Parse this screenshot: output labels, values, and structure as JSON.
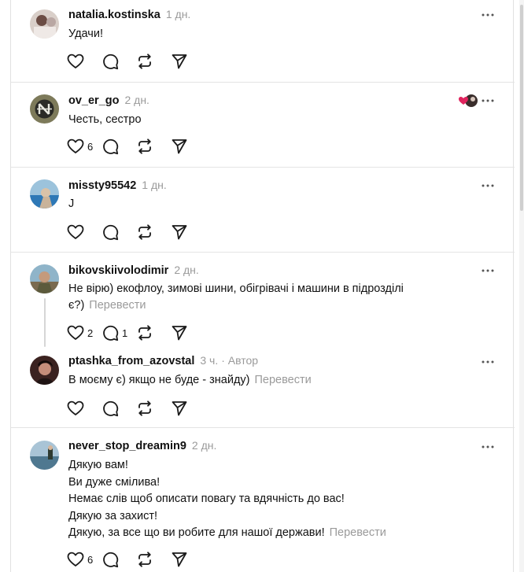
{
  "posts": [
    {
      "username": "natalia.kostinska",
      "time": "1 дн.",
      "lines": [
        "Удачи!"
      ],
      "translate": "",
      "likes": "",
      "replies": ""
    },
    {
      "username": "ov_er_go",
      "time": "2 дн.",
      "lines": [
        "Честь, сестро"
      ],
      "translate": "",
      "likes": "6",
      "replies": ""
    },
    {
      "username": "missty95542",
      "time": "1 дн.",
      "lines": [
        "J"
      ],
      "translate": "",
      "likes": "",
      "replies": ""
    },
    {
      "username": "bikovskiivolodimir",
      "time": "2 дн.",
      "lines": [
        "Не вірю) екофлоу, зимові шини, обігрівачі і машини в підрозділі",
        "є?)"
      ],
      "translate": "Перевести",
      "likes": "2",
      "replies": "1"
    },
    {
      "username": "ptashka_from_azovstal",
      "time": "3 ч.",
      "author_badge": "· Автор",
      "lines": [
        "В моєму є) якщо не буде - знайду)"
      ],
      "translate": "Перевести",
      "likes": "",
      "replies": ""
    },
    {
      "username": "never_stop_dreamin9",
      "time": "2 дн.",
      "lines": [
        "Дякую вам!",
        "Ви дуже смілива!",
        "Немає слів щоб описати повагу та вдячність до вас!",
        "Дякую за захист!",
        "Дякую, за все що ви робите для нашої держави!"
      ],
      "translate": "Перевести",
      "likes": "6",
      "replies": ""
    }
  ],
  "icons": {
    "like": "heart-icon",
    "reply": "comment-icon",
    "repost": "repost-icon",
    "share": "send-icon",
    "more": "more-options-icon"
  },
  "colors": {
    "secondary_text": "#9a9a9a",
    "divider": "#e4e4e4",
    "reaction_heart": "#e0245e"
  }
}
